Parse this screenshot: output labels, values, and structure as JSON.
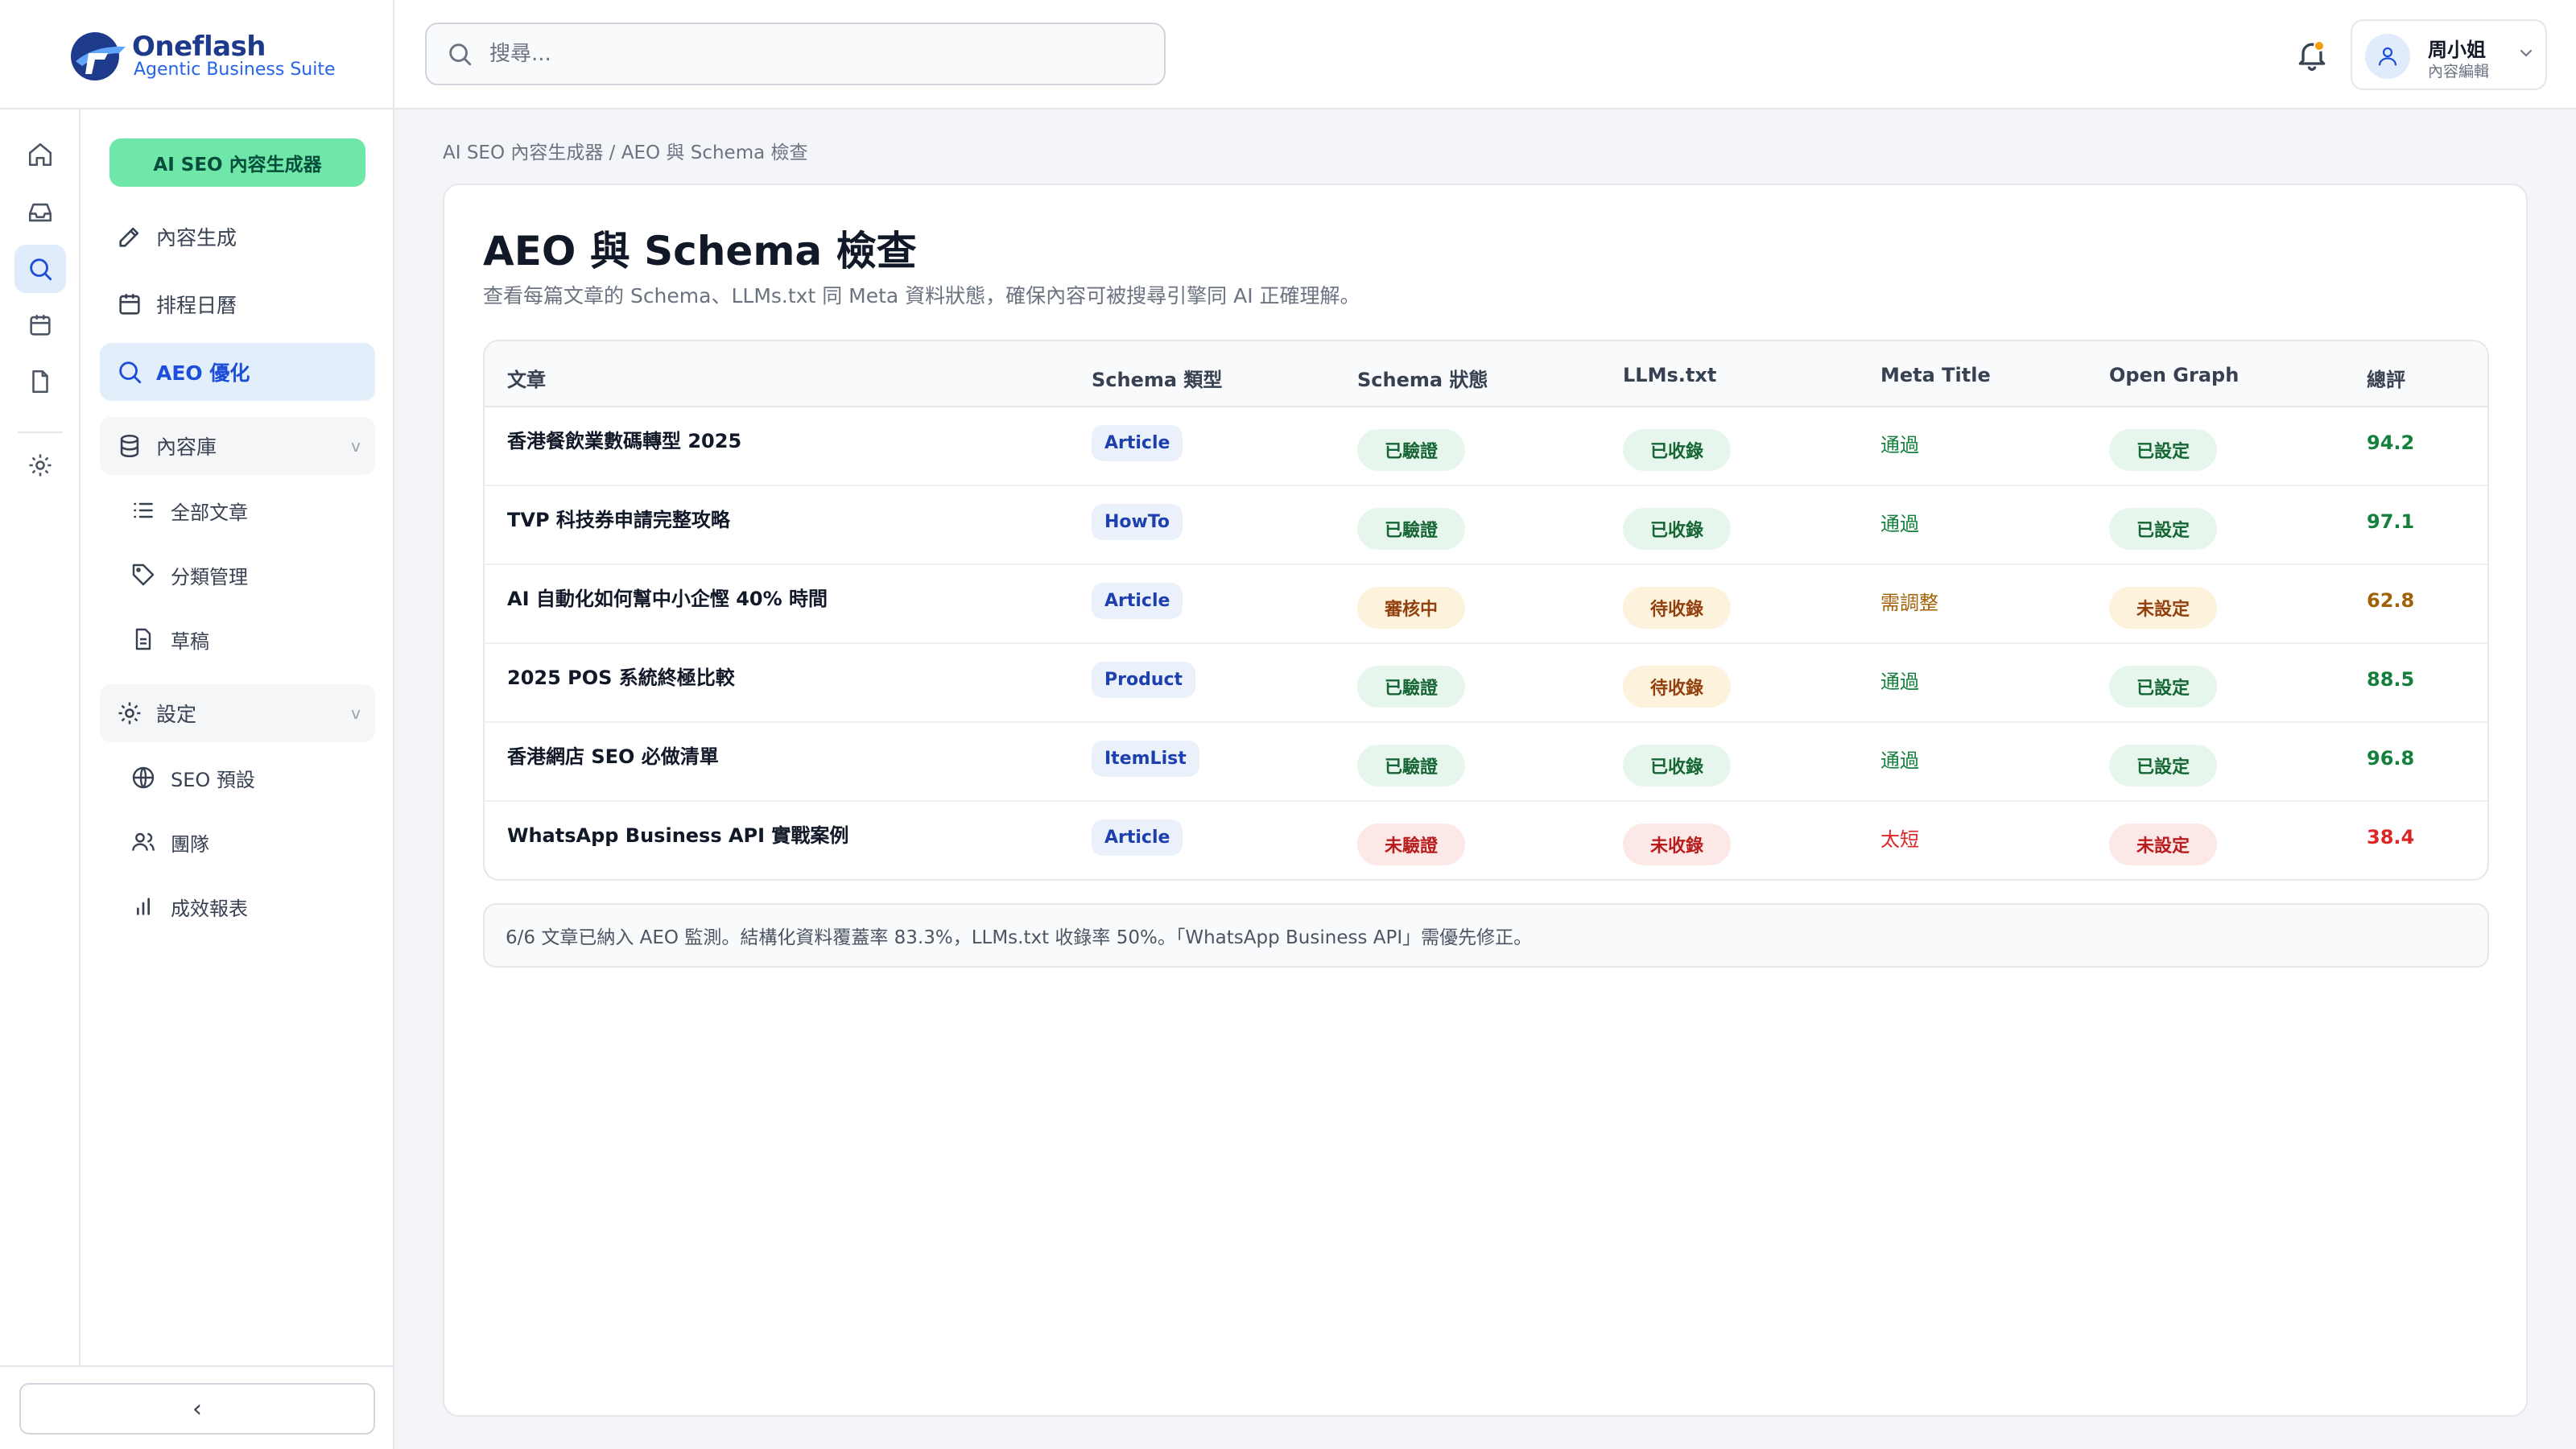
{
  "brand": {
    "name": "Oneflash",
    "tagline": "Agentic Business Suite"
  },
  "rail": {
    "items": [
      {
        "name": "home-icon"
      },
      {
        "name": "inbox-icon"
      },
      {
        "name": "search-icon",
        "active": true
      },
      {
        "name": "calendar-icon"
      },
      {
        "name": "file-icon"
      },
      {
        "name": "gear-icon"
      }
    ]
  },
  "nav": {
    "generator_label": "AI SEO 內容生成器",
    "items": {
      "content": "內容生成",
      "schedule": "排程日曆",
      "aeo": "AEO 優化",
      "library": "內容庫",
      "all_articles": "全部文章",
      "categories": "分類管理",
      "drafts": "草稿",
      "settings": "設定",
      "seo_presets": "SEO 預設",
      "team": "團隊",
      "reports": "成效報表"
    },
    "collapse_icon": "‹"
  },
  "topbar": {
    "search_placeholder": "搜尋...",
    "user": {
      "name": "周小姐",
      "role": "內容編輯"
    }
  },
  "breadcrumb": "AI SEO 內容生成器 / AEO 與 Schema 檢查",
  "page": {
    "title": "AEO 與 Schema 檢查",
    "subtitle": "查看每篇文章的 Schema、LLMs.txt 同 Meta 資料狀態，確保內容可被搜尋引擎同 AI 正確理解。"
  },
  "table": {
    "headers": {
      "article": "文章",
      "schema_type": "Schema 類型",
      "schema_status": "Schema 狀態",
      "llms": "LLMs.txt",
      "meta_title": "Meta Title",
      "open_graph": "Open Graph",
      "score": "總評"
    },
    "rows": [
      {
        "title": "香港餐飲業數碼轉型 2025",
        "type": "Article",
        "schema": "已驗證",
        "schema_level": "ok",
        "llms": "已收錄",
        "llms_level": "ok",
        "meta": "通過",
        "meta_level": "ok",
        "og": "已設定",
        "og_level": "ok",
        "score": "94.2",
        "score_level": "ok"
      },
      {
        "title": "TVP 科技券申請完整攻略",
        "type": "HowTo",
        "schema": "已驗證",
        "schema_level": "ok",
        "llms": "已收錄",
        "llms_level": "ok",
        "meta": "通過",
        "meta_level": "ok",
        "og": "已設定",
        "og_level": "ok",
        "score": "97.1",
        "score_level": "ok"
      },
      {
        "title": "AI 自動化如何幫中小企慳 40% 時間",
        "type": "Article",
        "schema": "審核中",
        "schema_level": "warn",
        "llms": "待收錄",
        "llms_level": "warn",
        "meta": "需調整",
        "meta_level": "warn",
        "og": "未設定",
        "og_level": "warn",
        "score": "62.8",
        "score_level": "warn"
      },
      {
        "title": "2025 POS 系統終極比較",
        "type": "Product",
        "schema": "已驗證",
        "schema_level": "ok",
        "llms": "待收錄",
        "llms_level": "warn",
        "meta": "通過",
        "meta_level": "ok",
        "og": "已設定",
        "og_level": "ok",
        "score": "88.5",
        "score_level": "ok"
      },
      {
        "title": "香港網店 SEO 必做清單",
        "type": "ItemList",
        "schema": "已驗證",
        "schema_level": "ok",
        "llms": "已收錄",
        "llms_level": "ok",
        "meta": "通過",
        "meta_level": "ok",
        "og": "已設定",
        "og_level": "ok",
        "score": "96.8",
        "score_level": "ok"
      },
      {
        "title": "WhatsApp Business API 實戰案例",
        "type": "Article",
        "schema": "未驗證",
        "schema_level": "bad",
        "llms": "未收錄",
        "llms_level": "bad",
        "meta": "太短",
        "meta_level": "bad",
        "og": "未設定",
        "og_level": "bad",
        "score": "38.4",
        "score_level": "bad"
      }
    ]
  },
  "summary": "6/6 文章已納入 AEO 監測。結構化資料覆蓋率 83.3%，LLMs.txt 收錄率 50%。「WhatsApp Business API」需優先修正。",
  "colors": {
    "accent": "#1d4ed8",
    "generator": "#6ee7a8",
    "ok": "#15803d",
    "warn": "#a16207",
    "bad": "#dc2626"
  }
}
